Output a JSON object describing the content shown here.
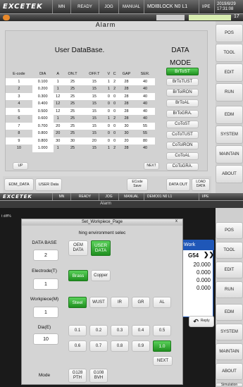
{
  "top": {
    "header": {
      "brand": "EXCETEK",
      "mode1": "MN",
      "mode2": "READY",
      "mode3": "JOG",
      "mode4": "MANUAL",
      "file": "MDIBLOCK N0 L1",
      "port": "I/PE",
      "date": "2019/8/29",
      "time": "17:31:08"
    },
    "title": "Alarm",
    "status_num": "17",
    "panel_title": "User DataBase.",
    "data_title": "DATA",
    "mode_title": "MODE",
    "columns": [
      "E-code",
      "DIA",
      "A",
      "ON.T",
      "OFF.T",
      "V",
      "C",
      "GAP",
      "SER."
    ],
    "rows": [
      [
        "1",
        "0.100",
        "1",
        "25",
        "15",
        "1",
        "2",
        "28",
        "40"
      ],
      [
        "2",
        "0.200",
        "1",
        "25",
        "15",
        "1",
        "2",
        "28",
        "40"
      ],
      [
        "3",
        "0.300",
        "12",
        "25",
        "15",
        "0",
        "0",
        "28",
        "40"
      ],
      [
        "4",
        "0.400",
        "12",
        "25",
        "15",
        "0",
        "0",
        "28",
        "40"
      ],
      [
        "5",
        "0.500",
        "12",
        "25",
        "15",
        "0",
        "0",
        "28",
        "40"
      ],
      [
        "6",
        "0.600",
        "1",
        "25",
        "15",
        "1",
        "2",
        "28",
        "40"
      ],
      [
        "7",
        "0.700",
        "20",
        "25",
        "15",
        "0",
        "0",
        "30",
        "55"
      ],
      [
        "8",
        "0.800",
        "20",
        "25",
        "15",
        "0",
        "0",
        "30",
        "55"
      ],
      [
        "9",
        "0.800",
        "30",
        "30",
        "20",
        "0",
        "0",
        "20",
        "80"
      ],
      [
        "10",
        "1.000",
        "1",
        "25",
        "15",
        "1",
        "2",
        "28",
        "40"
      ]
    ],
    "mode_buttons": [
      "BrToST",
      "BrToTUST",
      "BrToIRON",
      "BrToAL",
      "BrToGRA.",
      "CoToST",
      "CoToTUST",
      "CoToIRON",
      "CoToAL",
      "CoToGRA."
    ],
    "up_label": "UP",
    "next_label": "NEXT",
    "bottom": {
      "edm_data": "EDM_DATA",
      "user_data": "USER Data",
      "ecode_save": "ECode Save",
      "data_out": "DATA OUT",
      "load_data": "LOAD DATA"
    },
    "side": [
      "POS",
      "TOOL",
      "EDIT",
      "RUN",
      "EDM",
      "SYSTEM",
      "MAINTAIN",
      "ABOUT"
    ]
  },
  "bottom": {
    "header": {
      "brand": "EXCETEK",
      "mode1": "MN",
      "mode2": "READY",
      "mode3": "JOG",
      "mode4": "MANUAL",
      "file": "DEMO01 N0 L1",
      "port": "I/PE"
    },
    "title": "Alarm",
    "dialog_title": "Set_Workpiece_Page",
    "close": "x",
    "left_label": "t diff%",
    "msg": "hing environment selec",
    "database": {
      "label": "DATA BASE",
      "value": "2",
      "opt1": "OEM DATA",
      "opt2": "USER DATA",
      "selected": "USER DATA"
    },
    "electrode": {
      "label": "Electrode(T)",
      "value": "1",
      "opt1": "Brass",
      "opt2": "Copper",
      "selected": "Brass"
    },
    "workpiece": {
      "label": "Workpiece(M)",
      "value": "1",
      "opts": [
        "Steel",
        "WUST",
        "IR",
        "GR",
        "AL"
      ],
      "selected": "Steel"
    },
    "dia": {
      "label": "Dia(E)",
      "value": "10",
      "opts": [
        "0.1",
        "0.2",
        "0.3",
        "0.4",
        "0.5",
        "0.6",
        "0.7",
        "0.8",
        "0.9",
        "1.0"
      ],
      "selected": "1.0"
    },
    "next_label": "NEXT",
    "mode": {
      "label": "Mode",
      "opt1": "G128 PTH",
      "opt2": "G108 BVH"
    },
    "work": {
      "title": "Work",
      "g": "G54",
      "vals": [
        "20.000",
        "0.000",
        "0.000",
        "0.000"
      ]
    },
    "reply": "Reply",
    "side": [
      "POS",
      "TOOL",
      "EDIT",
      "RUN",
      "EDM",
      "SYSTEM",
      "MAINTAIN",
      "ABOUT",
      "Simulation"
    ]
  },
  "colors": {
    "green": "#2aa62a",
    "blue": "#1f57b8",
    "highlight": "#f1ef8a",
    "table_bg": "#d2d2d2"
  }
}
